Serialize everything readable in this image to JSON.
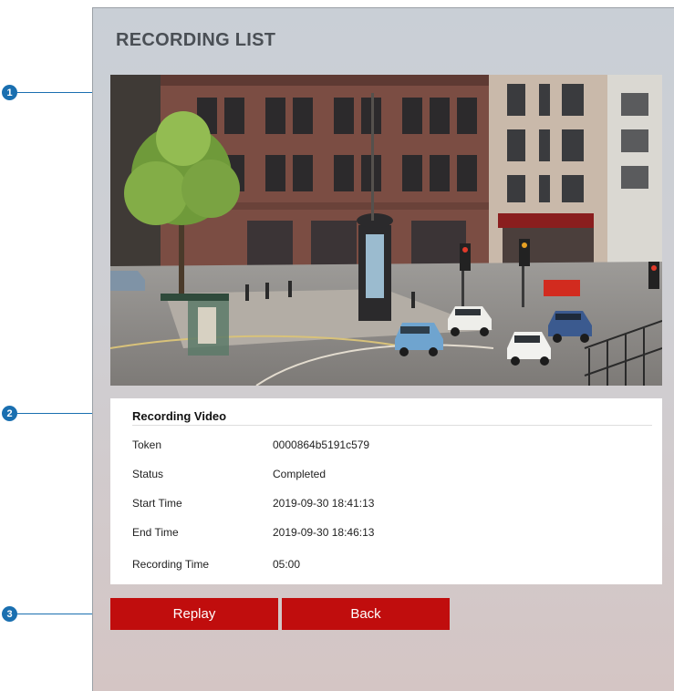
{
  "page": {
    "title": "RECORDING LIST"
  },
  "recording": {
    "section_title": "Recording Video",
    "rows": [
      {
        "label": "Token",
        "value": "0000864b5191c579"
      },
      {
        "label": "Status",
        "value": "Completed"
      },
      {
        "label": "Start Time",
        "value": "2019-09-30 18:41:13"
      },
      {
        "label": "End Time",
        "value": "2019-09-30 18:46:13"
      },
      {
        "label": "Recording Time",
        "value": "05:00"
      }
    ]
  },
  "buttons": {
    "replay": "Replay",
    "back": "Back"
  },
  "callouts": [
    "1",
    "2",
    "3"
  ],
  "colors": {
    "accent_red": "#c00d0d",
    "callout_blue": "#1a6fb0"
  }
}
